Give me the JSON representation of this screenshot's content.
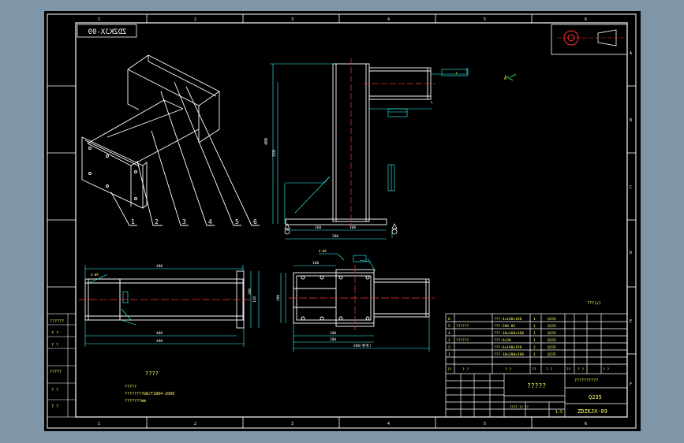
{
  "drawing_no_mirrored": "ZDZKJX-09",
  "border": {
    "top_numbers": [
      "1",
      "2",
      "3",
      "4",
      "5",
      "6"
    ],
    "bottom_numbers": [
      "1",
      "2",
      "3",
      "4",
      "5",
      "6"
    ],
    "side_letters": [
      "A",
      "B",
      "C",
      "D",
      "E",
      "F"
    ]
  },
  "iso_balloons": [
    "1",
    "2",
    "3",
    "4",
    "5",
    "6"
  ],
  "dims": {
    "side_height": "400",
    "side_left": "320",
    "side_bot1": "160",
    "side_bot2": "100",
    "side_bot_total": "280",
    "front_dim": "400",
    "front_overall": "480",
    "front_right": "120",
    "top_dim1": "160",
    "top_dim2": "100",
    "top_dim3": "280",
    "top_overall": "480(参考)"
  },
  "notes": {
    "title": "????",
    "lines": [
      "?????",
      "????????GB/T1804-2000",
      "???????mm"
    ]
  },
  "roughness_note": "???(√)",
  "left_strip": [
    "??????",
    "? ?",
    "? ?",
    "?????",
    "? ?",
    "? ?"
  ],
  "bom": {
    "rows": [
      {
        "no": "6",
        "name": "",
        "spec": "???-4x160x160",
        "qty": "1",
        "mat": "Q235"
      },
      {
        "no": "5",
        "name": "??????",
        "spec": "???-200 05",
        "qty": "1",
        "mat": "Q235"
      },
      {
        "no": "4",
        "name": "",
        "spec": "???-10x160x160",
        "qty": "1",
        "mat": "Q235"
      },
      {
        "no": "3",
        "name": "??????",
        "spec": "???-6x30",
        "qty": "1",
        "mat": "Q235"
      },
      {
        "no": "2",
        "name": "",
        "spec": "???-6x160x150",
        "qty": "2",
        "mat": "Q235"
      },
      {
        "no": "1",
        "name": "",
        "spec": "???-10x200x200",
        "qty": "1",
        "mat": "Q235"
      }
    ],
    "header": [
      "??",
      "? ?",
      "? ?",
      "??",
      "? ?",
      "??",
      "? ?",
      "? ?"
    ]
  },
  "title_block": {
    "part_name": "?????",
    "company": "??????????",
    "material": "Q235",
    "drawing_no": "ZDZKJX-09",
    "scale": "1:5",
    "sheet_info": "???? ?? ??"
  }
}
